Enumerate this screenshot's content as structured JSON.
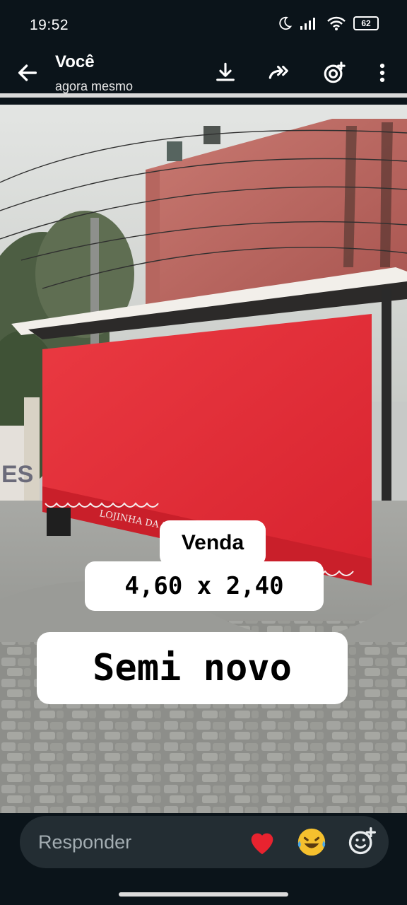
{
  "status_bar": {
    "time": "19:52",
    "battery": "62",
    "icons": [
      "moon-icon",
      "signal-icon",
      "wifi-icon",
      "battery-icon"
    ]
  },
  "header": {
    "title": "Você",
    "subtitle": "agora mesmo",
    "icons": [
      "back-arrow-icon",
      "download-icon",
      "forward-icon",
      "add-status-icon",
      "more-vert-icon"
    ]
  },
  "progress": {
    "fraction": 1.0
  },
  "photo": {
    "sign_text": "LOJINHA DA RAQUEL",
    "wall_text": "ES"
  },
  "captions": {
    "line1": "Venda",
    "line2": "4,60 x 2,40",
    "line3": "Semi novo"
  },
  "reply_bar": {
    "placeholder": "Responder",
    "reactions": [
      "heart-emoji",
      "laughing-tears-emoji",
      "add-reaction-icon"
    ]
  },
  "colors": {
    "background": "#0b141a",
    "reply_bar": "#232d33",
    "awning_red": "#e8333b"
  }
}
